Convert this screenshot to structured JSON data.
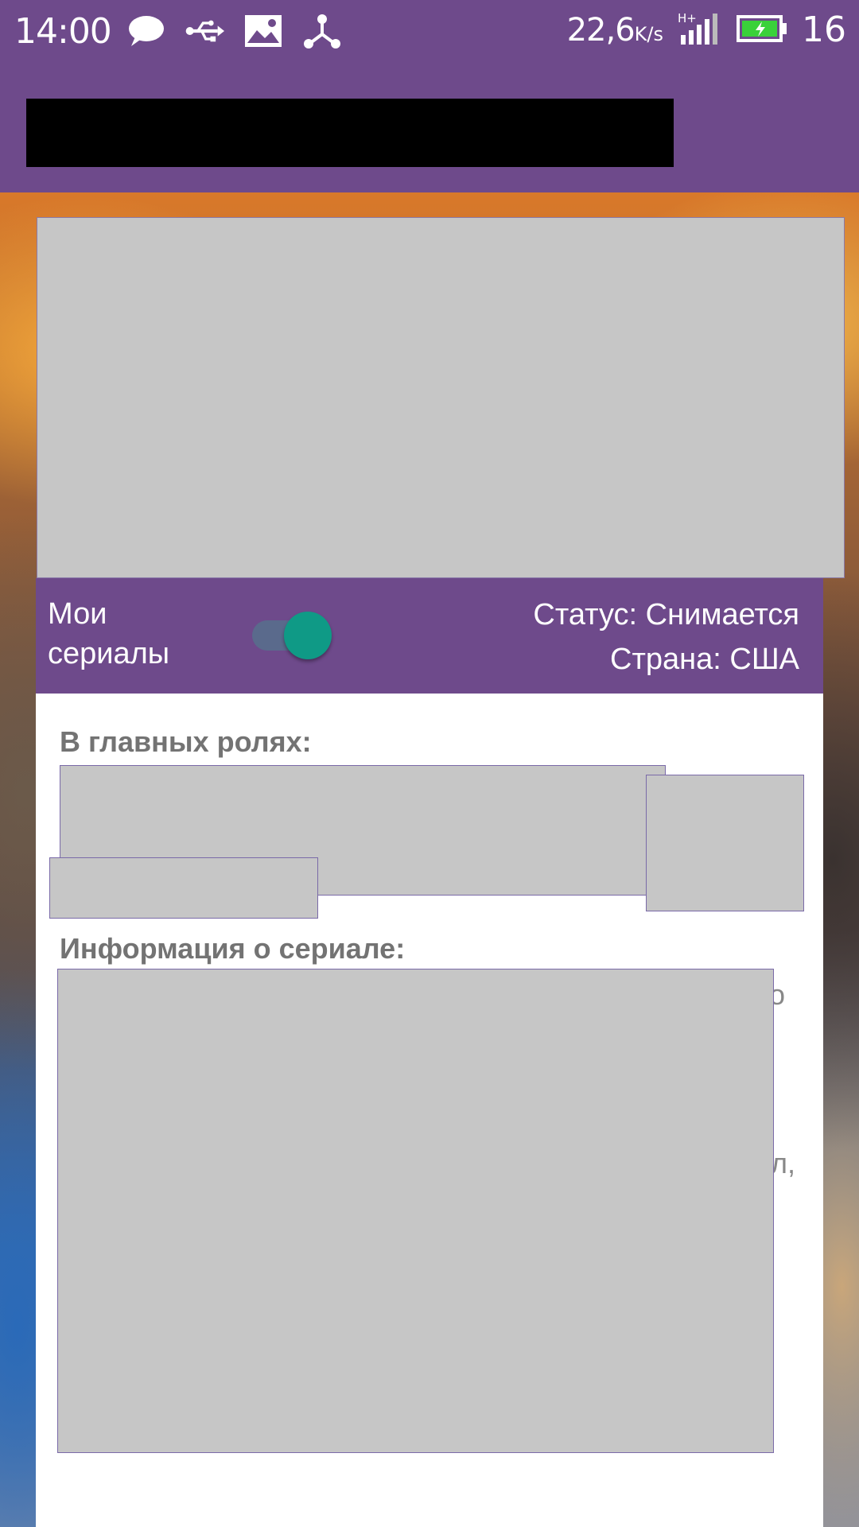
{
  "status_bar": {
    "time": "14:00",
    "icons_left": [
      "chat-bubble-icon",
      "usb-icon",
      "image-icon",
      "share-node-icon"
    ],
    "net_speed": "22,6",
    "net_speed_unit": "K/s",
    "signal_label": "H+",
    "battery_level": "16"
  },
  "info_bar": {
    "my_series_label": "Мои сериалы",
    "my_series_toggle_on": true,
    "status_line": "Статус: Снимается",
    "country_line": "Страна: США"
  },
  "content": {
    "cast_heading": "В главных ролях:",
    "info_heading": "Информация о сериале:"
  },
  "colors": {
    "primary": "#6e4a8b",
    "toggle_thumb": "#0f9a86",
    "placeholder": "#c6c6c6",
    "heading_text": "#737373"
  }
}
